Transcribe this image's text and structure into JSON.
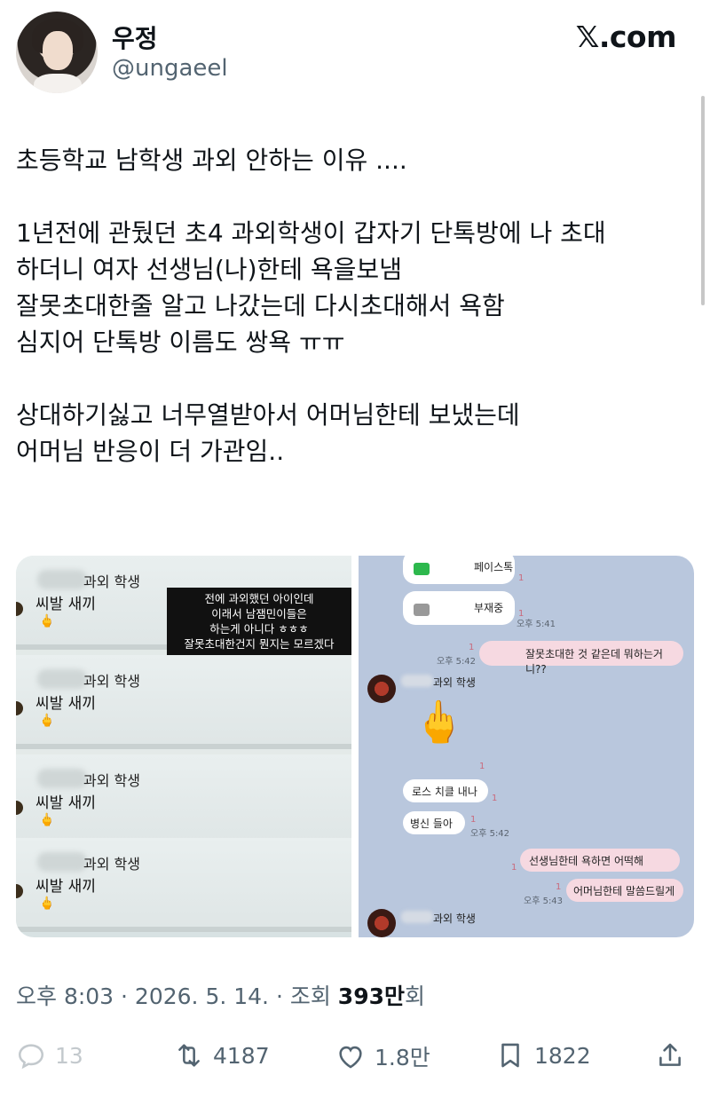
{
  "tweet": {
    "display_name": "우정",
    "handle": "@ungaeel",
    "brand": "𝕏.com",
    "text": "초등학교 남학생 과외 안하는 이유 ....\n\n1년전에 관뒀던 초4 과외학생이 갑자기 단톡방에 나 초대\n하더니 여자 선생님(나)한테 욕을보냄\n잘못초대한줄 알고 나갔는데 다시초대해서 욕함\n심지어 단톡방 이름도 쌍욕 ㅠㅠ\n\n상대하기싫고 너무열받아서 어머님한테 보냈는데\n어머님 반응이 더 가관임..",
    "timestamp": "오후 8:03 · 2026. 5. 14. · 조회 ",
    "views_number": "393만",
    "views_suffix": "회"
  },
  "media_left": {
    "strips": [
      {
        "name": "과외 학생",
        "line": "씨발 새끼",
        "emoji": "🖕"
      },
      {
        "name": "과외 학생",
        "line": "씨발 새끼",
        "emoji": "🖕"
      },
      {
        "name": "과외 학생",
        "line": "씨발 새끼",
        "emoji": "🖕"
      },
      {
        "name": "과외 학생",
        "line": "씨발 새끼",
        "emoji": "🖕"
      }
    ],
    "caption": [
      "전에 과외했던 아이인데",
      "이래서 남잼민이들은",
      "하는게 아니다 ㅎㅎㅎ",
      "잘못초대한건지 뭔지는 모르겠다"
    ]
  },
  "media_right": {
    "call1": "페이스톡",
    "call2": "부재중",
    "time1": "오후 5:41",
    "msg1": "잘못초대한 것 같은데 뭐하는거니??",
    "time2": "오후 5:42",
    "sender": "과외 학생",
    "emoji": "🖕",
    "msg2": "로스 치클 내나",
    "msg3": "병신 들아",
    "time3": "오후 5:42",
    "msg4": "선생님한테 욕하면 어떡해",
    "msg5": "어머님한테 말씀드릴게",
    "time4": "오후 5:43",
    "unread": "1"
  },
  "actions": {
    "reply": "13",
    "retweet": "4187",
    "like": "1.8만",
    "bookmark": "1822"
  },
  "colors": {
    "text": "#0f1419",
    "secondary": "#536471",
    "chat_bg": "#b9c7dd",
    "my_bubble": "#f6d9e1"
  }
}
